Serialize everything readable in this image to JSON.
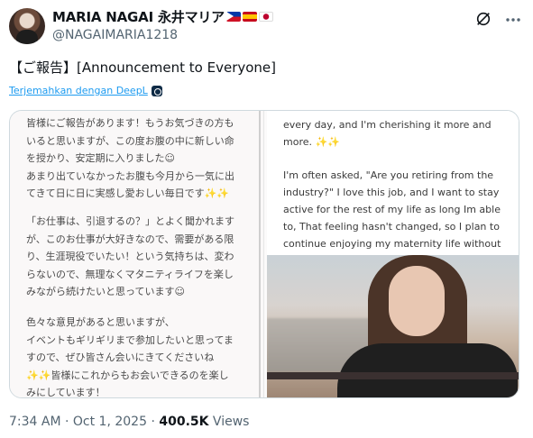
{
  "author": {
    "display_name": "MARIA NAGAI 永井マリア",
    "handle": "@NAGAIMARIA1218",
    "flags": [
      "philippines-flag",
      "spain-flag",
      "japan-flag"
    ]
  },
  "icons": {
    "grok": "grok-icon",
    "more": "more-icon",
    "translate": "deepl-icon"
  },
  "tweet": {
    "text": "【ご報告】[Announcement to Everyone]",
    "translate_label": "Terjemahkan dengan DeepL"
  },
  "image_left_jp": {
    "p1": "皆様にご報告があります！もうお気づきの方も\nいると思いますが、この度お腹の中に新しい命\nを授かり、安定期に入りました☺\nあまり出ていなかったお腹も今月から一気に出\nてきて日に日に実感し愛おしい毎日です✨✨",
    "p2": "「お仕事は、引退するの？」とよく聞かれます\nが、このお仕事が大好きなので、需要がある限\nり、生涯現役でいたい！という気持ちは、変わ\nらないので、無理なくマタニティライフを楽し\nみながら続けたいと思っています☺",
    "p3": "色々な意見があると思いますが、\nイベントもギリギリまで参加したいと思ってま\nすので、ぜひ皆さん会いにきてくださいね\n✨✨皆様にこれからもお会いできるのを楽し\nみにしています！"
  },
  "image_right_en": {
    "p1": "every day, and I'm cherishing it more and\nmore. ✨✨",
    "p2": "I'm often asked, \"Are you retiring from the\nindustry?\" I love this job, and I want to stay\nactive for the rest of my life as long Im able\nto, That feeling hasn't changed, so I plan to\ncontinue enjoying my maternity life without"
  },
  "meta": {
    "time": "7:34 AM · Oct 1, 2025 · ",
    "views_count": "400.5K",
    "views_label": " Views"
  }
}
